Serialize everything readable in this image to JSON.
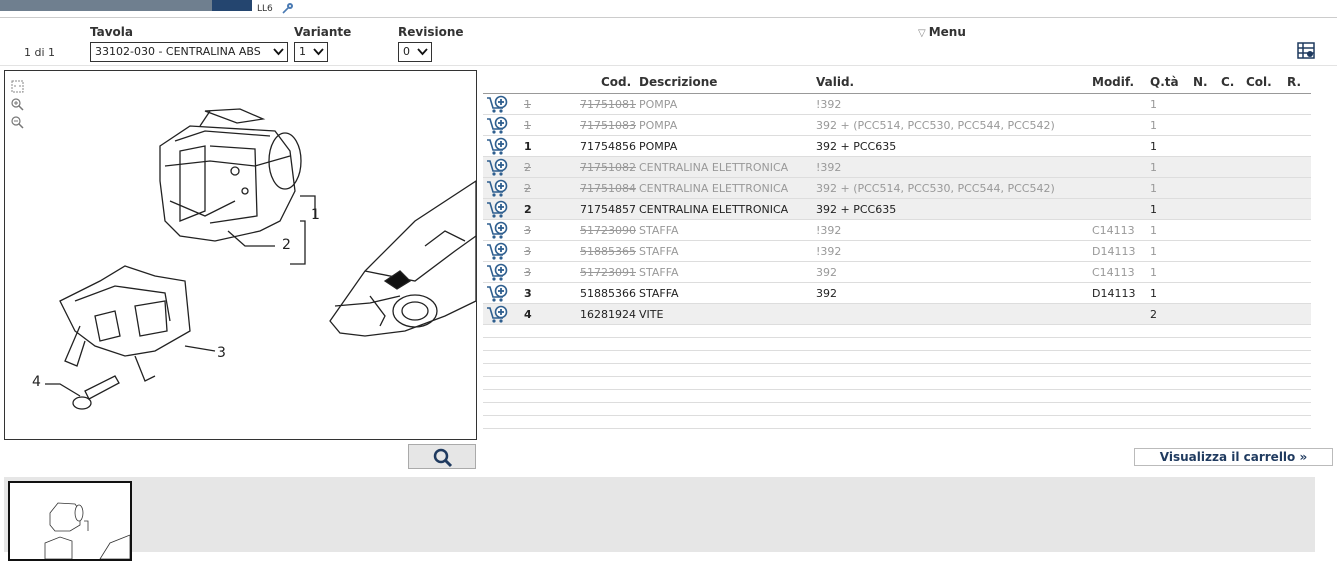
{
  "top": {
    "tag": "LL6"
  },
  "header": {
    "page_count": "1 di 1",
    "tavola_label": "Tavola",
    "tavola_value": "33102-030 - CENTRALINA ABS",
    "variante_label": "Variante",
    "variante_value": "1",
    "revisione_label": "Revisione",
    "revisione_value": "0",
    "menu_label": "Menu"
  },
  "drawing": {
    "callouts": [
      "1",
      "2",
      "3",
      "4"
    ]
  },
  "table": {
    "columns": {
      "cod": "Cod.",
      "desc": "Descrizione",
      "valid": "Valid.",
      "modif": "Modif.",
      "qty": "Q.tà",
      "n": "N.",
      "c": "C.",
      "col": "Col.",
      "r": "R."
    },
    "rows": [
      {
        "pos": "1",
        "cod": "71751081",
        "desc": "POMPA",
        "valid": "!392",
        "modif": "",
        "qty": "1",
        "active": false
      },
      {
        "pos": "1",
        "cod": "71751083",
        "desc": "POMPA",
        "valid": "392 + (PCC514, PCC530, PCC544, PCC542)",
        "modif": "",
        "qty": "1",
        "active": false
      },
      {
        "pos": "1",
        "cod": "71754856",
        "desc": "POMPA",
        "valid": "392 + PCC635",
        "modif": "",
        "qty": "1",
        "active": true
      },
      {
        "pos": "2",
        "cod": "71751082",
        "desc": "CENTRALINA ELETTRONICA",
        "valid": "!392",
        "modif": "",
        "qty": "1",
        "active": false
      },
      {
        "pos": "2",
        "cod": "71751084",
        "desc": "CENTRALINA ELETTRONICA",
        "valid": "392 + (PCC514, PCC530, PCC544, PCC542)",
        "modif": "",
        "qty": "1",
        "active": false
      },
      {
        "pos": "2",
        "cod": "71754857",
        "desc": "CENTRALINA ELETTRONICA",
        "valid": "392 + PCC635",
        "modif": "",
        "qty": "1",
        "active": true
      },
      {
        "pos": "3",
        "cod": "51723090",
        "desc": "STAFFA",
        "valid": "!392",
        "modif": "C14113",
        "qty": "1",
        "active": false
      },
      {
        "pos": "3",
        "cod": "51885365",
        "desc": "STAFFA",
        "valid": "!392",
        "modif": "D14113",
        "qty": "1",
        "active": false
      },
      {
        "pos": "3",
        "cod": "51723091",
        "desc": "STAFFA",
        "valid": "392",
        "modif": "C14113",
        "qty": "1",
        "active": false
      },
      {
        "pos": "3",
        "cod": "51885366",
        "desc": "STAFFA",
        "valid": "392",
        "modif": "D14113",
        "qty": "1",
        "active": true
      },
      {
        "pos": "4",
        "cod": "16281924",
        "desc": "VITE",
        "valid": "",
        "modif": "",
        "qty": "2",
        "active": true
      }
    ]
  },
  "cart_link": "Visualizza il carrello »",
  "colors": {
    "accent": "#1f3a5f",
    "cart_icon": "#2f5f8f"
  },
  "icons": [
    "key-icon",
    "chevron-down-icon",
    "settings-list-icon",
    "fit-icon",
    "zoom-in-icon",
    "zoom-out-icon",
    "search-icon",
    "add-to-cart-icon"
  ]
}
